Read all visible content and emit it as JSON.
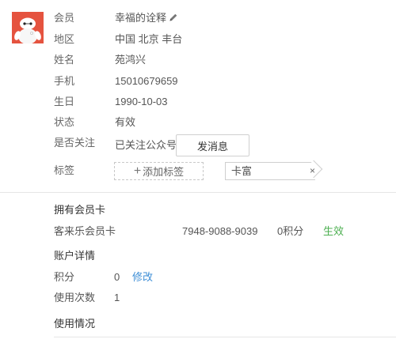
{
  "profile": {
    "fields": [
      {
        "label": "会员",
        "value": "幸福的诠释"
      },
      {
        "label": "地区",
        "value": "中国 北京 丰台"
      },
      {
        "label": "姓名",
        "value": "苑鸿兴"
      },
      {
        "label": "手机",
        "value": "15010679659"
      },
      {
        "label": "生日",
        "value": "1990-10-03"
      },
      {
        "label": "状态",
        "value": "有效"
      },
      {
        "label": "是否关注",
        "value": "已关注公众号"
      },
      {
        "label": "标签",
        "value": ""
      }
    ],
    "send_message_label": "发消息",
    "add_tag_label": "添加标签",
    "add_tag_plus": "+",
    "tags": [
      "卡富"
    ],
    "tag_remove": "×"
  },
  "member_card": {
    "title": "拥有会员卡",
    "name": "客来乐会员卡",
    "number": "7948-9088-9039",
    "points": "0积分",
    "status": "生效"
  },
  "account": {
    "title": "账户详情",
    "points_label": "积分",
    "points_value": "0",
    "edit_label": "修改",
    "usage_count_label": "使用次数",
    "usage_count_value": "1"
  },
  "usage": {
    "title": "使用情况"
  },
  "colors": {
    "avatar_bg": "#e5533f",
    "link": "#3d8ed6",
    "status_active": "#4caf50"
  },
  "icons": {
    "avatar": "baymax-avatar",
    "edit": "pencil-icon",
    "add": "plus-icon",
    "remove": "close-icon"
  }
}
